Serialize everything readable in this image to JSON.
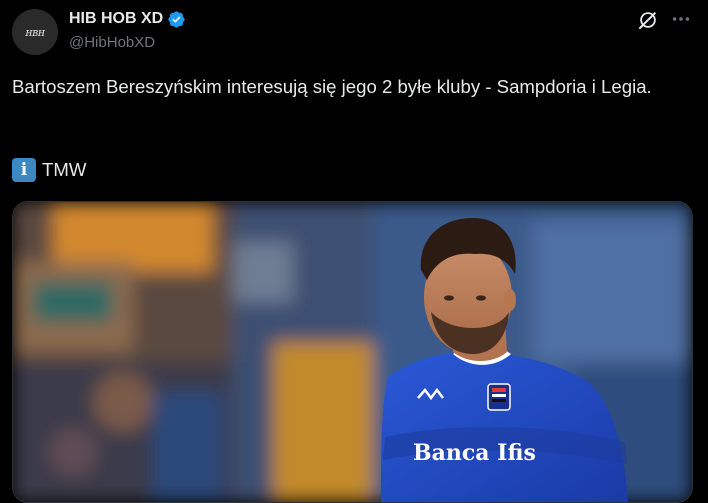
{
  "author": {
    "display_name": "HIB HOB XD",
    "handle": "@HibHobXD",
    "avatar_text": "ʜʙʜ",
    "verified": true
  },
  "tweet": {
    "text": "Bartoszem Bereszyńskim interesują się jego 2 byłe kluby - Sampdoria i Legia.",
    "source_icon": "information-icon",
    "source_text": "TMW"
  },
  "media": {
    "alt": "Football player in blue Sampdoria shirt",
    "sponsor_text": "Banca Ifis"
  },
  "colors": {
    "background": "#000000",
    "text": "#e7e9ea",
    "secondary": "#71767b",
    "verified": "#1d9bf0",
    "shirt": "#1f47c4"
  },
  "icons": {
    "verified": "verified-badge-icon",
    "grok": "grok-icon",
    "more": "more-icon"
  }
}
